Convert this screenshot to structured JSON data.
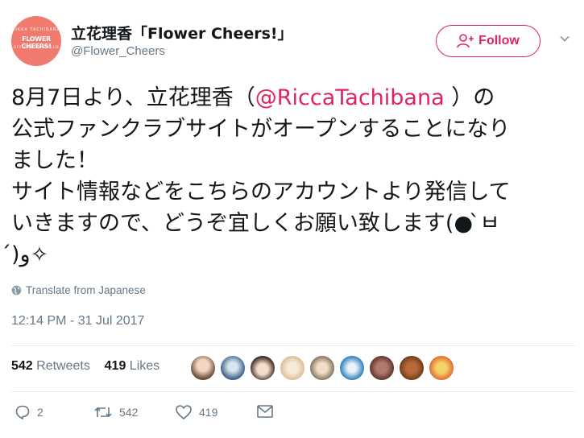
{
  "author": {
    "name": "立花理香「Flower Cheers!」",
    "handle": "@Flower_Cheers",
    "avatar_text": {
      "top": "RIKKA TACHIBANA",
      "main": "FLOWER CHEERS!",
      "bottom": "OFFICIAL FAN CLUB"
    }
  },
  "follow_label": "Follow",
  "tweet": {
    "line1_pre": "8月7日より、立花理香（",
    "mention": "@RiccaTachibana",
    "line1_post": " ）の",
    "line2": "公式ファンクラブサイトがオープンすることになり",
    "line3": "ました！",
    "line4": "サイト情報などをこちらのアカウントより発信して",
    "line5": "いきますので、どうぞ宜しくお願い致します(● ̀ㅂ",
    "line6": "́)ﻭ✧"
  },
  "translate_label": "Translate from Japanese",
  "timestamp": "12:14 PM - 31 Jul 2017",
  "stats": {
    "retweets_count": "542",
    "retweets_label": "Retweets",
    "likes_count": "419",
    "likes_label": "Likes"
  },
  "actions": {
    "replies": "2",
    "retweets": "542",
    "likes": "419"
  },
  "colors": {
    "accent": "#e0245e",
    "muted": "#657786",
    "avatar_bg": "#f07a6e"
  }
}
